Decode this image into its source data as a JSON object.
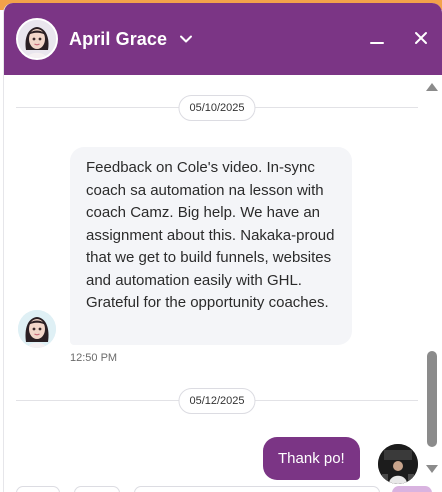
{
  "header": {
    "contact_name": "April Grace",
    "avatar_icon": "female-avatar-icon",
    "accent_color": "#7b3585"
  },
  "thread": {
    "separators": [
      "05/10/2025",
      "05/12/2025"
    ],
    "incoming": {
      "text": "Feedback on Cole's video. In-sync coach sa automation na lesson with coach Camz. Big help. We have an assignment about this. Nakaka-proud that we get to build funnels, websites and automation easily with GHL. Grateful for the opportunity coaches.",
      "time": "12:50 PM"
    },
    "outgoing": {
      "text": "Thank po!"
    }
  }
}
